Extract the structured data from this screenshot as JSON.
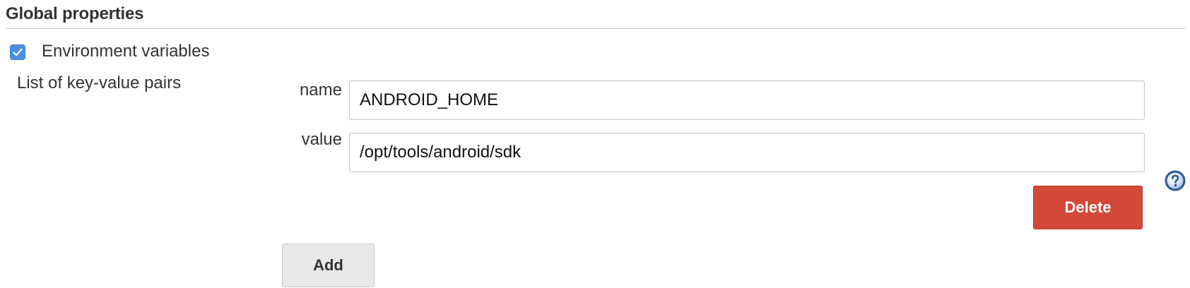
{
  "section": {
    "title": "Global properties"
  },
  "env_vars": {
    "checkbox_label": "Environment variables",
    "checked": true,
    "list_label": "List of key-value pairs",
    "pairs": [
      {
        "name_label": "name",
        "name_value": "ANDROID_HOME",
        "value_label": "value",
        "value_value": "/opt/tools/android/sdk"
      }
    ],
    "delete_label": "Delete",
    "add_label": "Add"
  },
  "icons": {
    "help": "help-icon",
    "check": "checkmark-icon"
  },
  "colors": {
    "checkbox": "#4a90e2",
    "delete_button": "#d24939",
    "add_button": "#e8e8e8",
    "help_icon": "#2a5a9a"
  }
}
